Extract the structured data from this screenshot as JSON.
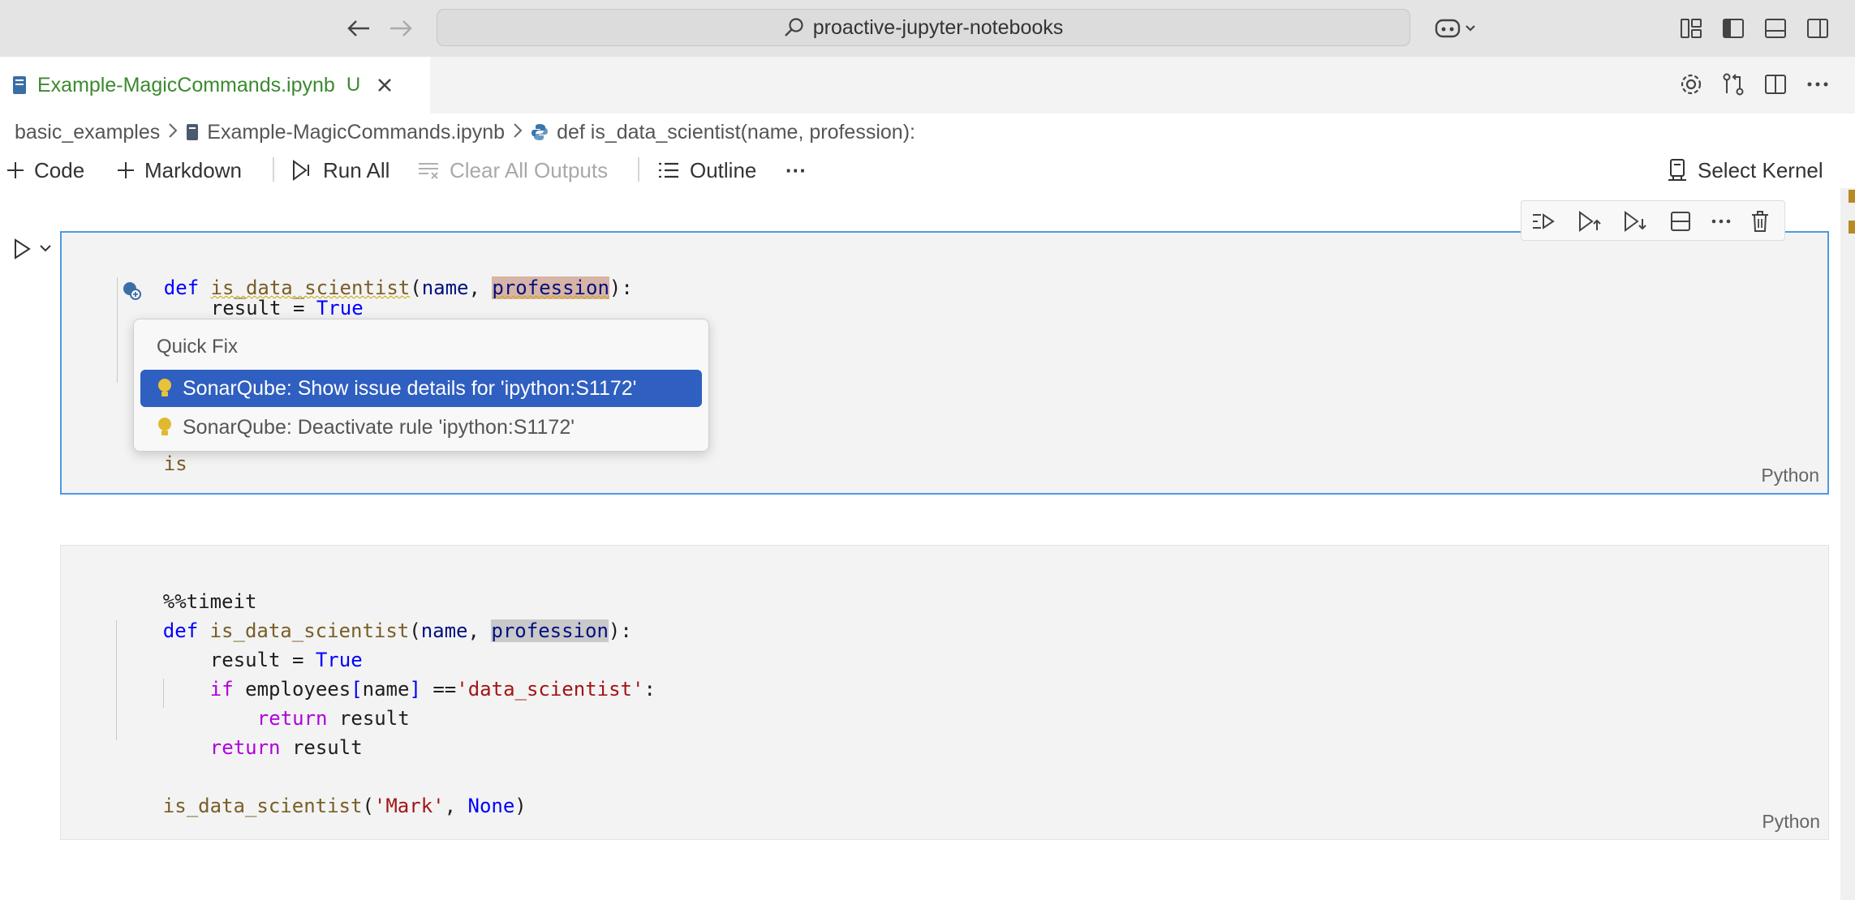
{
  "titlebar": {
    "address": "proactive-jupyter-notebooks"
  },
  "tab": {
    "title": "Example-MagicCommands.ipynb",
    "status": "U"
  },
  "breadcrumb": {
    "folder": "basic_examples",
    "file": "Example-MagicCommands.ipynb",
    "symbol": "def is_data_scientist(name, profession):"
  },
  "toolbar": {
    "code": "Code",
    "markdown": "Markdown",
    "run_all": "Run All",
    "clear_outputs": "Clear All Outputs",
    "outline": "Outline",
    "more": "···",
    "select_kernel": "Select Kernel"
  },
  "cell1": {
    "lang": "Python",
    "line1_def": "def",
    "line1_fn": "is_data_scientist",
    "line1_p1": "(",
    "line1_arg1": "name",
    "line1_comma": ", ",
    "line1_arg2": "profession",
    "line1_end": "):",
    "line2_a": "result = ",
    "line2_b": "True",
    "line_last": "is"
  },
  "quickfix": {
    "title": "Quick Fix",
    "items": [
      "SonarQube: Show issue details for 'ipython:S1172'",
      "SonarQube: Deactivate rule 'ipython:S1172'"
    ]
  },
  "cell2": {
    "lang": "Python",
    "l1": "%%timeit",
    "l2_def": "def",
    "l2_fn": "is_data_scientist",
    "l2_p": "(",
    "l2_a1": "name",
    "l2_c": ", ",
    "l2_a2": "profession",
    "l2_e": "):",
    "l3_a": "result = ",
    "l3_b": "True",
    "l4_if": "if",
    "l4_emp": " employees",
    "l4_br1": "[",
    "l4_name": "name",
    "l4_br2": "]",
    "l4_eq": " ==",
    "l4_str": "'data_scientist'",
    "l4_colon": ":",
    "l5_ret": "return",
    "l5_res": " result",
    "l6_ret": "return",
    "l6_res": " result",
    "l7_fn": "is_data_scientist",
    "l7_p": "(",
    "l7_s": "'Mark'",
    "l7_c": ", ",
    "l7_none": "None",
    "l7_e": ")"
  }
}
